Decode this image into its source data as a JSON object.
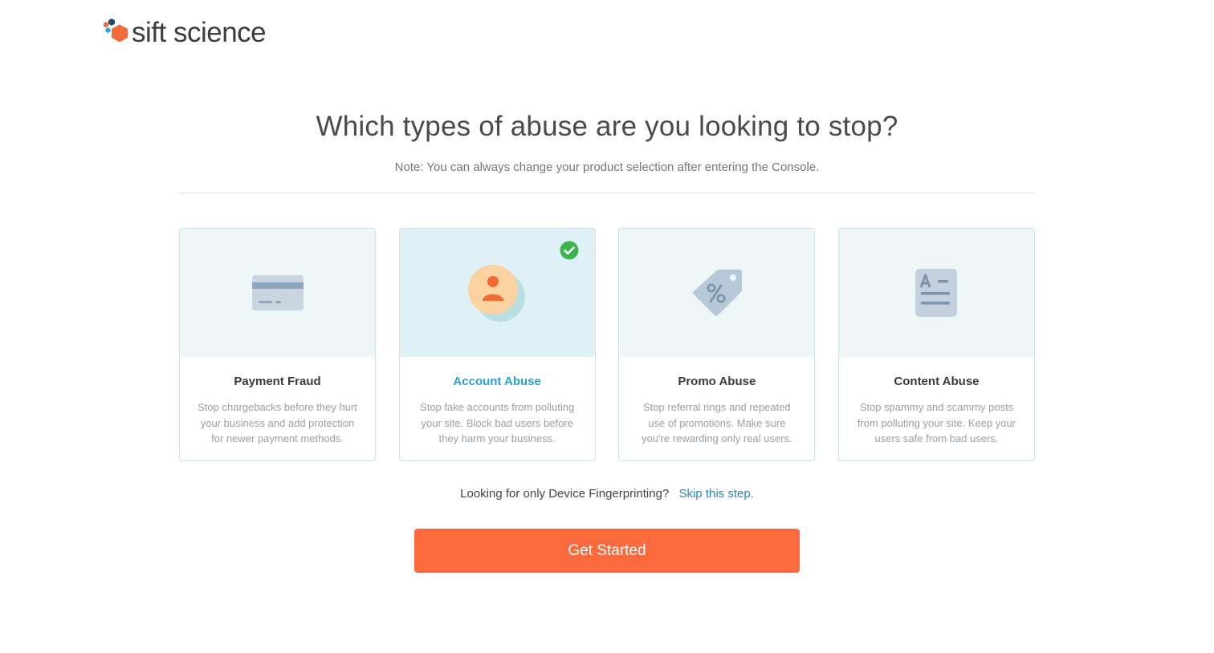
{
  "logo": {
    "text": "sift science"
  },
  "header": {
    "title": "Which types of abuse are you looking to stop?",
    "note": "Note: You can always change your product selection after entering the Console."
  },
  "cards": [
    {
      "title": "Payment Fraud",
      "description": "Stop chargebacks before they hurt your business and add protection for newer payment methods.",
      "icon": "credit-card-icon",
      "selected": false
    },
    {
      "title": "Account Abuse",
      "description": "Stop fake accounts from polluting your site. Block bad users before they harm your business.",
      "icon": "user-avatar-icon",
      "selected": true
    },
    {
      "title": "Promo Abuse",
      "description": "Stop referral rings and repeated use of promotions. Make sure you're rewarding only real users.",
      "icon": "discount-tag-icon",
      "selected": false
    },
    {
      "title": "Content Abuse",
      "description": "Stop spammy and scammy posts from polluting your site. Keep your users safe from bad users.",
      "icon": "document-icon",
      "selected": false
    }
  ],
  "skip": {
    "prompt": "Looking for only Device Fingerprinting?",
    "link": "Skip this step."
  },
  "cta": {
    "label": "Get Started"
  },
  "colors": {
    "accent": "#fa6a3c",
    "link": "#2f86b7",
    "selected_title": "#2c9fd0",
    "check": "#3bb54a",
    "card_top": "#eef6f8",
    "card_top_selected": "#dff0f7"
  }
}
